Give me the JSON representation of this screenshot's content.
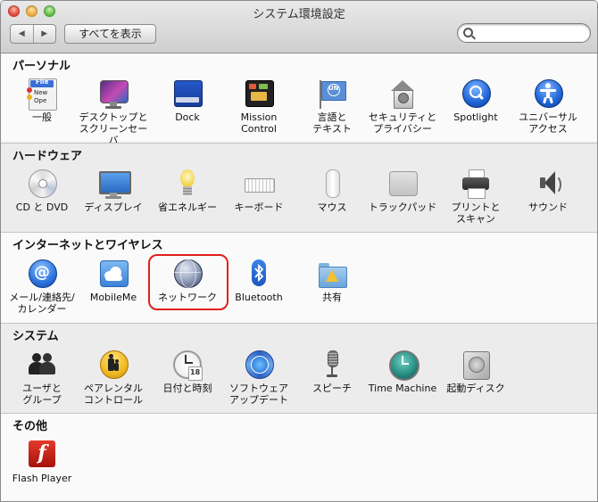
{
  "window": {
    "title": "システム環境設定"
  },
  "toolbar": {
    "back_glyph": "◀",
    "forward_glyph": "▶",
    "show_all": "すべてを表示",
    "search_value": "",
    "search_placeholder": ""
  },
  "sections": {
    "personal": {
      "title": "パーソナル",
      "items": [
        "一般",
        "デスクトップと\nスクリーンセーバ",
        "Dock",
        "Mission\nControl",
        "言語と\nテキスト",
        "セキュリティと\nプライバシー",
        "Spotlight",
        "ユニバーサル\nアクセス"
      ]
    },
    "hardware": {
      "title": "ハードウェア",
      "items": [
        "CD と DVD",
        "ディスプレイ",
        "省エネルギー",
        "キーボード",
        "マウス",
        "トラックパッド",
        "プリントと\nスキャン",
        "サウンド"
      ]
    },
    "internet": {
      "title": "インターネットとワイヤレス",
      "items": [
        "メール/連絡先/\nカレンダー",
        "MobileMe",
        "ネットワーク",
        "Bluetooth",
        "共有"
      ]
    },
    "system": {
      "title": "システム",
      "items": [
        "ユーザと\nグループ",
        "ペアレンタル\nコントロール",
        "日付と時刻",
        "ソフトウェア\nアップデート",
        "スピーチ",
        "Time Machine",
        "起動ディスク"
      ]
    },
    "other": {
      "title": "その他",
      "items": [
        "Flash Player"
      ]
    }
  },
  "icon_text": {
    "general_file": "File",
    "general_new": "New",
    "general_open": "Ope",
    "language_un": "UN",
    "calendar_day": "18",
    "mail_at": "@",
    "flash_f": "f"
  },
  "colors": {
    "highlight": "#e0211c",
    "accent_blue": "#2f6fd6"
  }
}
